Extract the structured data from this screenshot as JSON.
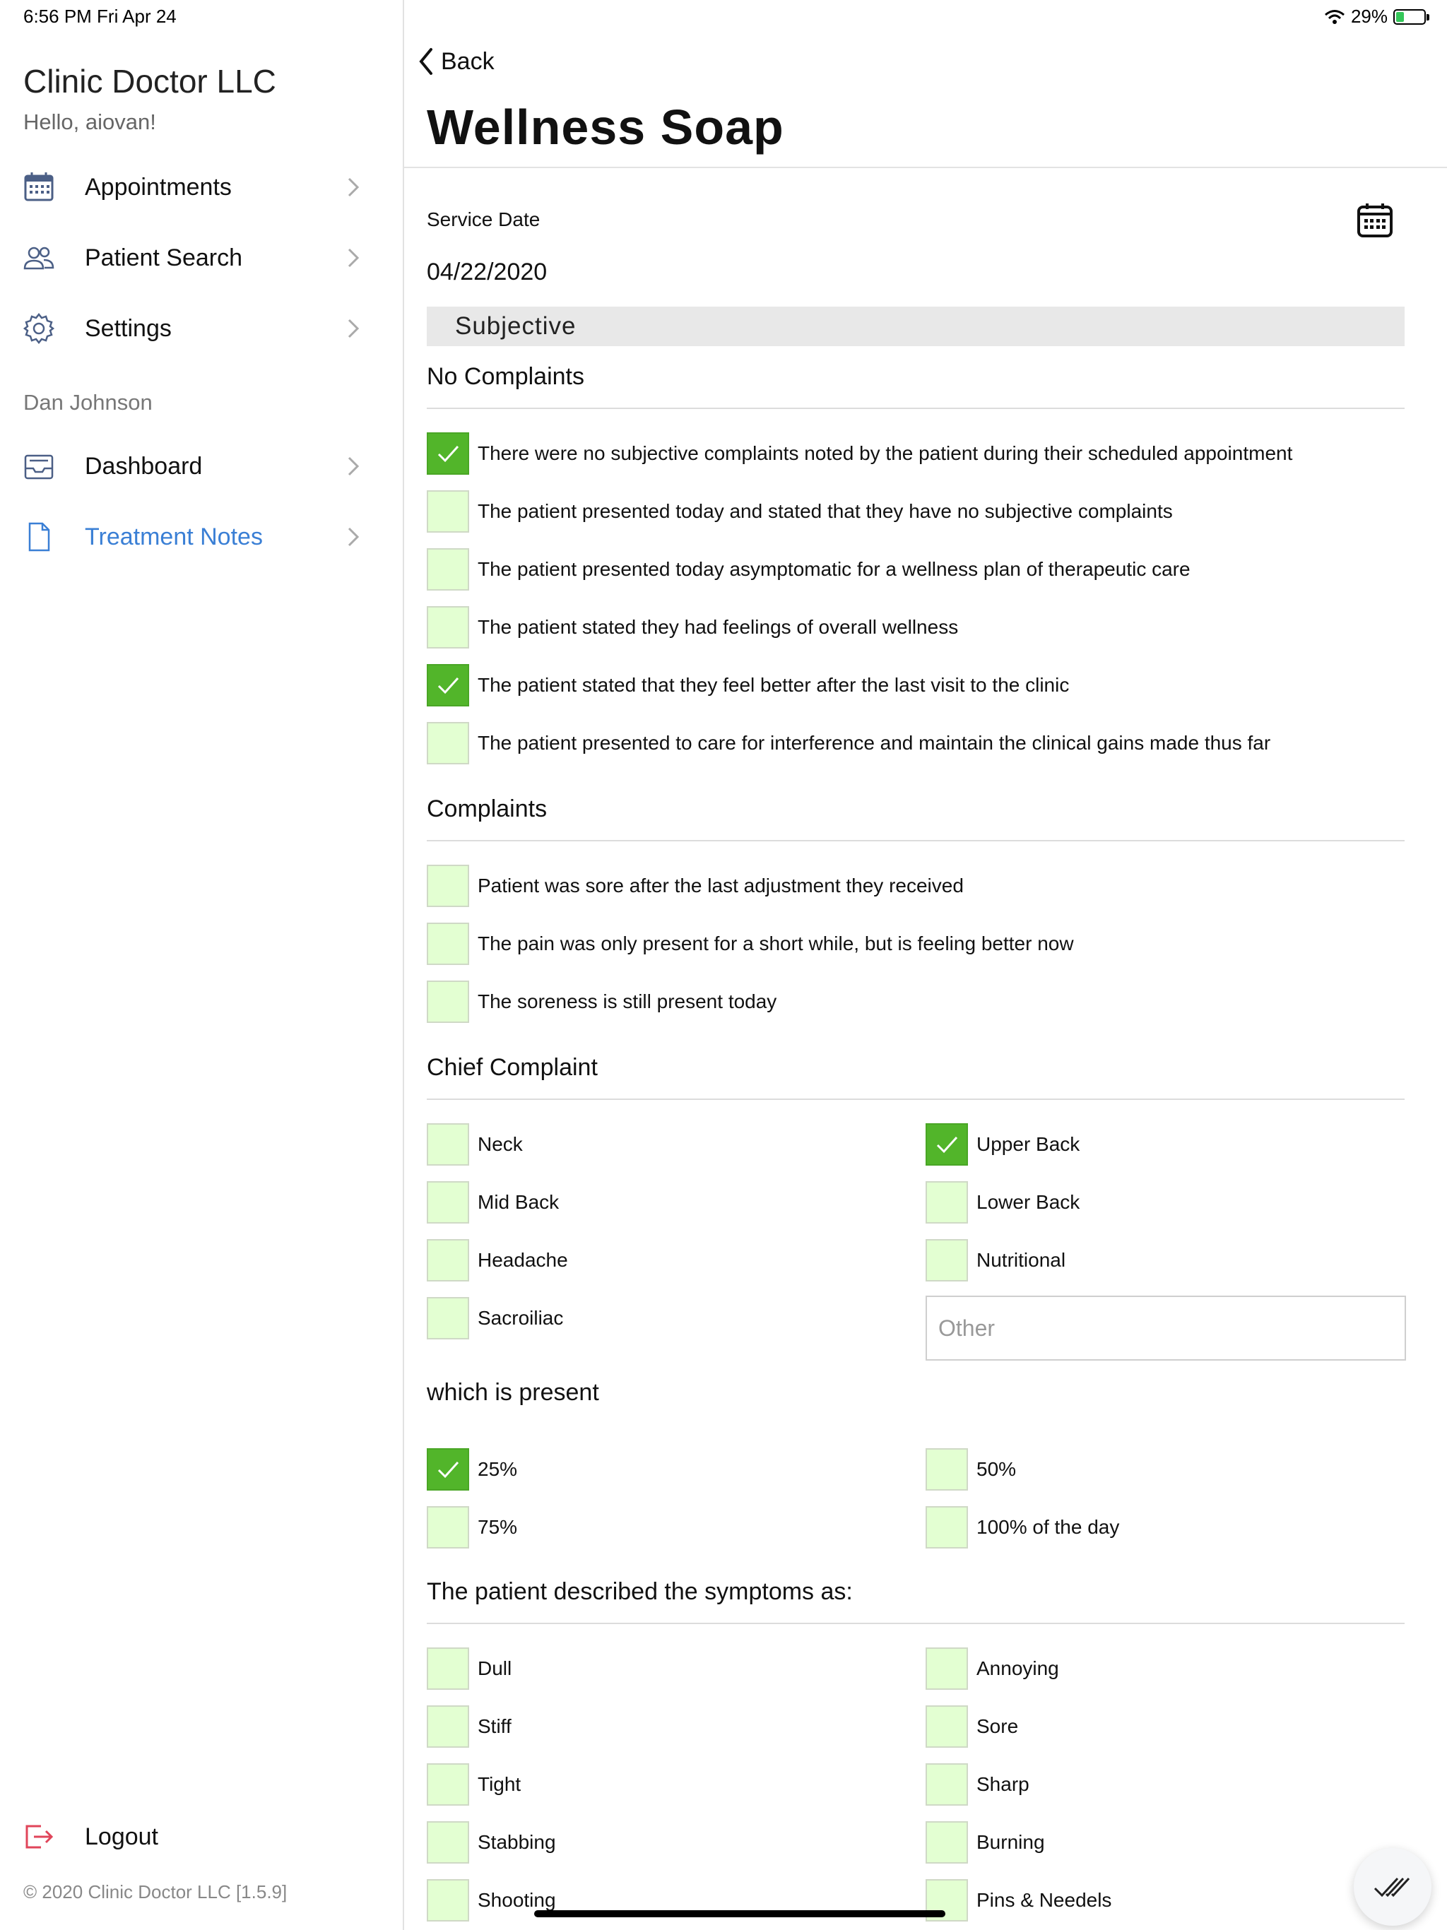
{
  "status": {
    "time": "6:56 PM   Fri Apr 24",
    "battery": "29%",
    "battery_level": 0.29
  },
  "sidebar": {
    "org_name": "Clinic Doctor LLC",
    "greeting": "Hello, aiovan!",
    "nav": [
      {
        "label": "Appointments",
        "icon": "calendar-icon"
      },
      {
        "label": "Patient Search",
        "icon": "users-icon"
      },
      {
        "label": "Settings",
        "icon": "gear-icon"
      }
    ],
    "section_label": "Dan Johnson",
    "patient_nav": [
      {
        "label": "Dashboard",
        "icon": "inbox-icon"
      },
      {
        "label": "Treatment Notes",
        "icon": "document-icon",
        "active": true
      }
    ],
    "logout_label": "Logout",
    "copyright": "© 2020 Clinic Doctor LLC [1.5.9]"
  },
  "header": {
    "back_label": "Back",
    "title": "Wellness Soap"
  },
  "form": {
    "service_date_label": "Service Date",
    "service_date": "04/22/2020",
    "section_title": "Subjective",
    "no_complaints": {
      "title": "No Complaints",
      "items": [
        {
          "label": "There were no subjective complaints noted by the patient during their scheduled appointment",
          "checked": true
        },
        {
          "label": "The patient presented today and stated that they have no subjective complaints",
          "checked": false
        },
        {
          "label": "The patient presented today asymptomatic for a wellness plan of therapeutic care",
          "checked": false
        },
        {
          "label": "The patient stated they had feelings of overall wellness",
          "checked": false
        },
        {
          "label": "The patient stated that they feel better after the last visit to the clinic",
          "checked": true
        },
        {
          "label": "The patient presented to care for interference and maintain the clinical gains made thus far",
          "checked": false
        }
      ]
    },
    "complaints": {
      "title": "Complaints",
      "items": [
        {
          "label": "Patient was sore after the last adjustment they received",
          "checked": false
        },
        {
          "label": "The pain was only present for a short while, but is feeling better now",
          "checked": false
        },
        {
          "label": "The soreness is still present today",
          "checked": false
        }
      ]
    },
    "chief_complaint": {
      "title": "Chief Complaint",
      "left": [
        {
          "label": "Neck",
          "checked": false
        },
        {
          "label": "Mid Back",
          "checked": false
        },
        {
          "label": "Headache",
          "checked": false
        },
        {
          "label": "Sacroiliac",
          "checked": false
        }
      ],
      "right": [
        {
          "label": "Upper Back",
          "checked": true
        },
        {
          "label": "Lower Back",
          "checked": false
        },
        {
          "label": "Nutritional",
          "checked": false
        }
      ],
      "other_placeholder": "Other"
    },
    "present": {
      "title": "which is present",
      "left": [
        {
          "label": "25%",
          "checked": true
        },
        {
          "label": "75%",
          "checked": false
        }
      ],
      "right": [
        {
          "label": "50%",
          "checked": false
        },
        {
          "label": "100% of the day",
          "checked": false
        }
      ]
    },
    "symptoms": {
      "title": "The patient described the symptoms as:",
      "left": [
        {
          "label": "Dull",
          "checked": false
        },
        {
          "label": "Stiff",
          "checked": false
        },
        {
          "label": "Tight",
          "checked": false
        },
        {
          "label": "Stabbing",
          "checked": false
        },
        {
          "label": "Shooting",
          "checked": false
        }
      ],
      "right": [
        {
          "label": "Annoying",
          "checked": false
        },
        {
          "label": "Sore",
          "checked": false
        },
        {
          "label": "Sharp",
          "checked": false
        },
        {
          "label": "Burning",
          "checked": false
        },
        {
          "label": "Pins & Needels",
          "checked": false
        }
      ]
    }
  },
  "colors": {
    "accent": "#3a7fd5",
    "check_on": "#52b52a",
    "check_off": "#e3ffd2",
    "logout": "#e0455a"
  }
}
